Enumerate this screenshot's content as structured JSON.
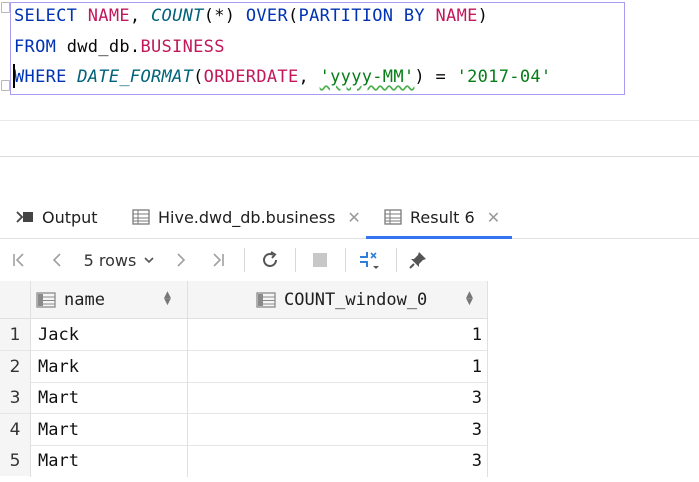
{
  "editor": {
    "line1": {
      "select": "SELECT",
      "name": "NAME",
      "comma": ",",
      "count": "COUNT",
      "star": "(*)",
      "over": "OVER",
      "paren_open": "(",
      "partition_by": "PARTITION BY",
      "name2": "NAME",
      "paren_close": ")"
    },
    "line2": {
      "from": "FROM",
      "db": "dwd_db",
      "dot": ".",
      "table": "BUSINESS"
    },
    "line3": {
      "where": "WHERE",
      "fn": "DATE_FORMAT",
      "paren_open": "(",
      "col": "ORDERDATE",
      "comma": ",",
      "fmt": "'yyyy-MM'",
      "paren_close": ")",
      "eq": "=",
      "value": "'2017-04'"
    }
  },
  "tabs": [
    {
      "label": "Output",
      "icon": "output-icon"
    },
    {
      "label": "Hive.dwd_db.business",
      "icon": "table-icon"
    },
    {
      "label": "Result 6",
      "icon": "table-icon"
    }
  ],
  "toolbar": {
    "rows_label": "5 rows",
    "icons": [
      "first-page-icon",
      "prev-page-icon",
      "next-page-icon",
      "last-page-icon",
      "refresh-icon",
      "stop-icon",
      "compare-icon",
      "pin-icon"
    ]
  },
  "grid": {
    "columns": [
      "name",
      "COUNT_window_0"
    ],
    "rows": [
      {
        "num": "1",
        "name": "Jack",
        "count": "1"
      },
      {
        "num": "2",
        "name": "Mark",
        "count": "1"
      },
      {
        "num": "3",
        "name": "Mart",
        "count": "3"
      },
      {
        "num": "4",
        "name": "Mart",
        "count": "3"
      },
      {
        "num": "5",
        "name": "Mart",
        "count": "3"
      }
    ]
  },
  "colors": {
    "keyword": "#0033b3",
    "identifier": "#c2185b",
    "function": "#00627a",
    "string": "#067d17",
    "selection_border": "#a89cf0",
    "active_tab": "#3574f0"
  }
}
